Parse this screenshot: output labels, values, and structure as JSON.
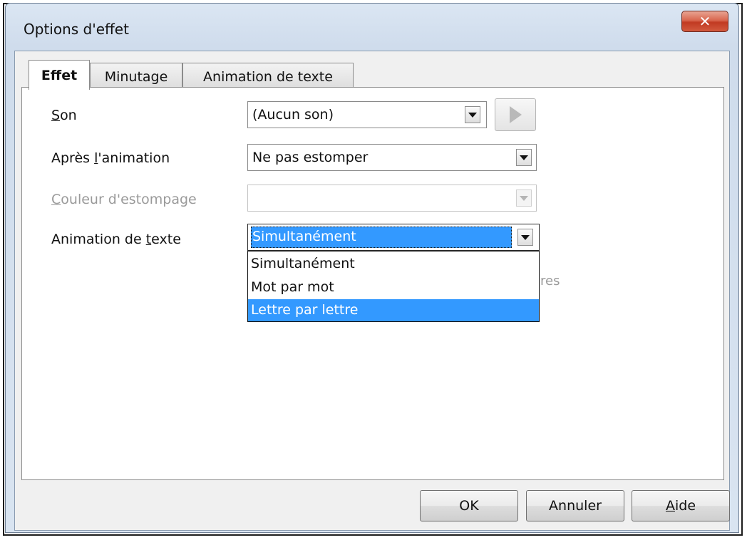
{
  "window": {
    "title": "Options d'effet",
    "close_glyph": "✕"
  },
  "tabs": [
    {
      "label": "Effet",
      "active": true
    },
    {
      "label": "Minutage",
      "active": false
    },
    {
      "label": "Animation de texte",
      "active": false
    }
  ],
  "fields": {
    "son": {
      "label_ul": "S",
      "label_rest": "on",
      "value": "(Aucun son)"
    },
    "apres": {
      "label_pre": "Après ",
      "label_ul": "l",
      "label_rest": "'animation",
      "value": "Ne pas estomper"
    },
    "couleur": {
      "label_ul": "C",
      "label_rest": "ouleur d'estompage",
      "value": "",
      "enabled": false
    },
    "animation_texte": {
      "label_pre": "Animation de ",
      "label_ul": "t",
      "label_rest": "exte",
      "value": "Simultanément"
    }
  },
  "dropdown": {
    "options": [
      "Simultanément",
      "Mot par mot",
      "Lettre par lettre"
    ],
    "highlighted_index": 2,
    "partial_hidden_text": "res"
  },
  "buttons": {
    "ok": "OK",
    "cancel": "Annuler",
    "help_ul": "A",
    "help_rest": "ide"
  },
  "colors": {
    "selection": "#3399ff",
    "close_button": "#c94a30",
    "disabled_text": "#9a9a9a"
  }
}
